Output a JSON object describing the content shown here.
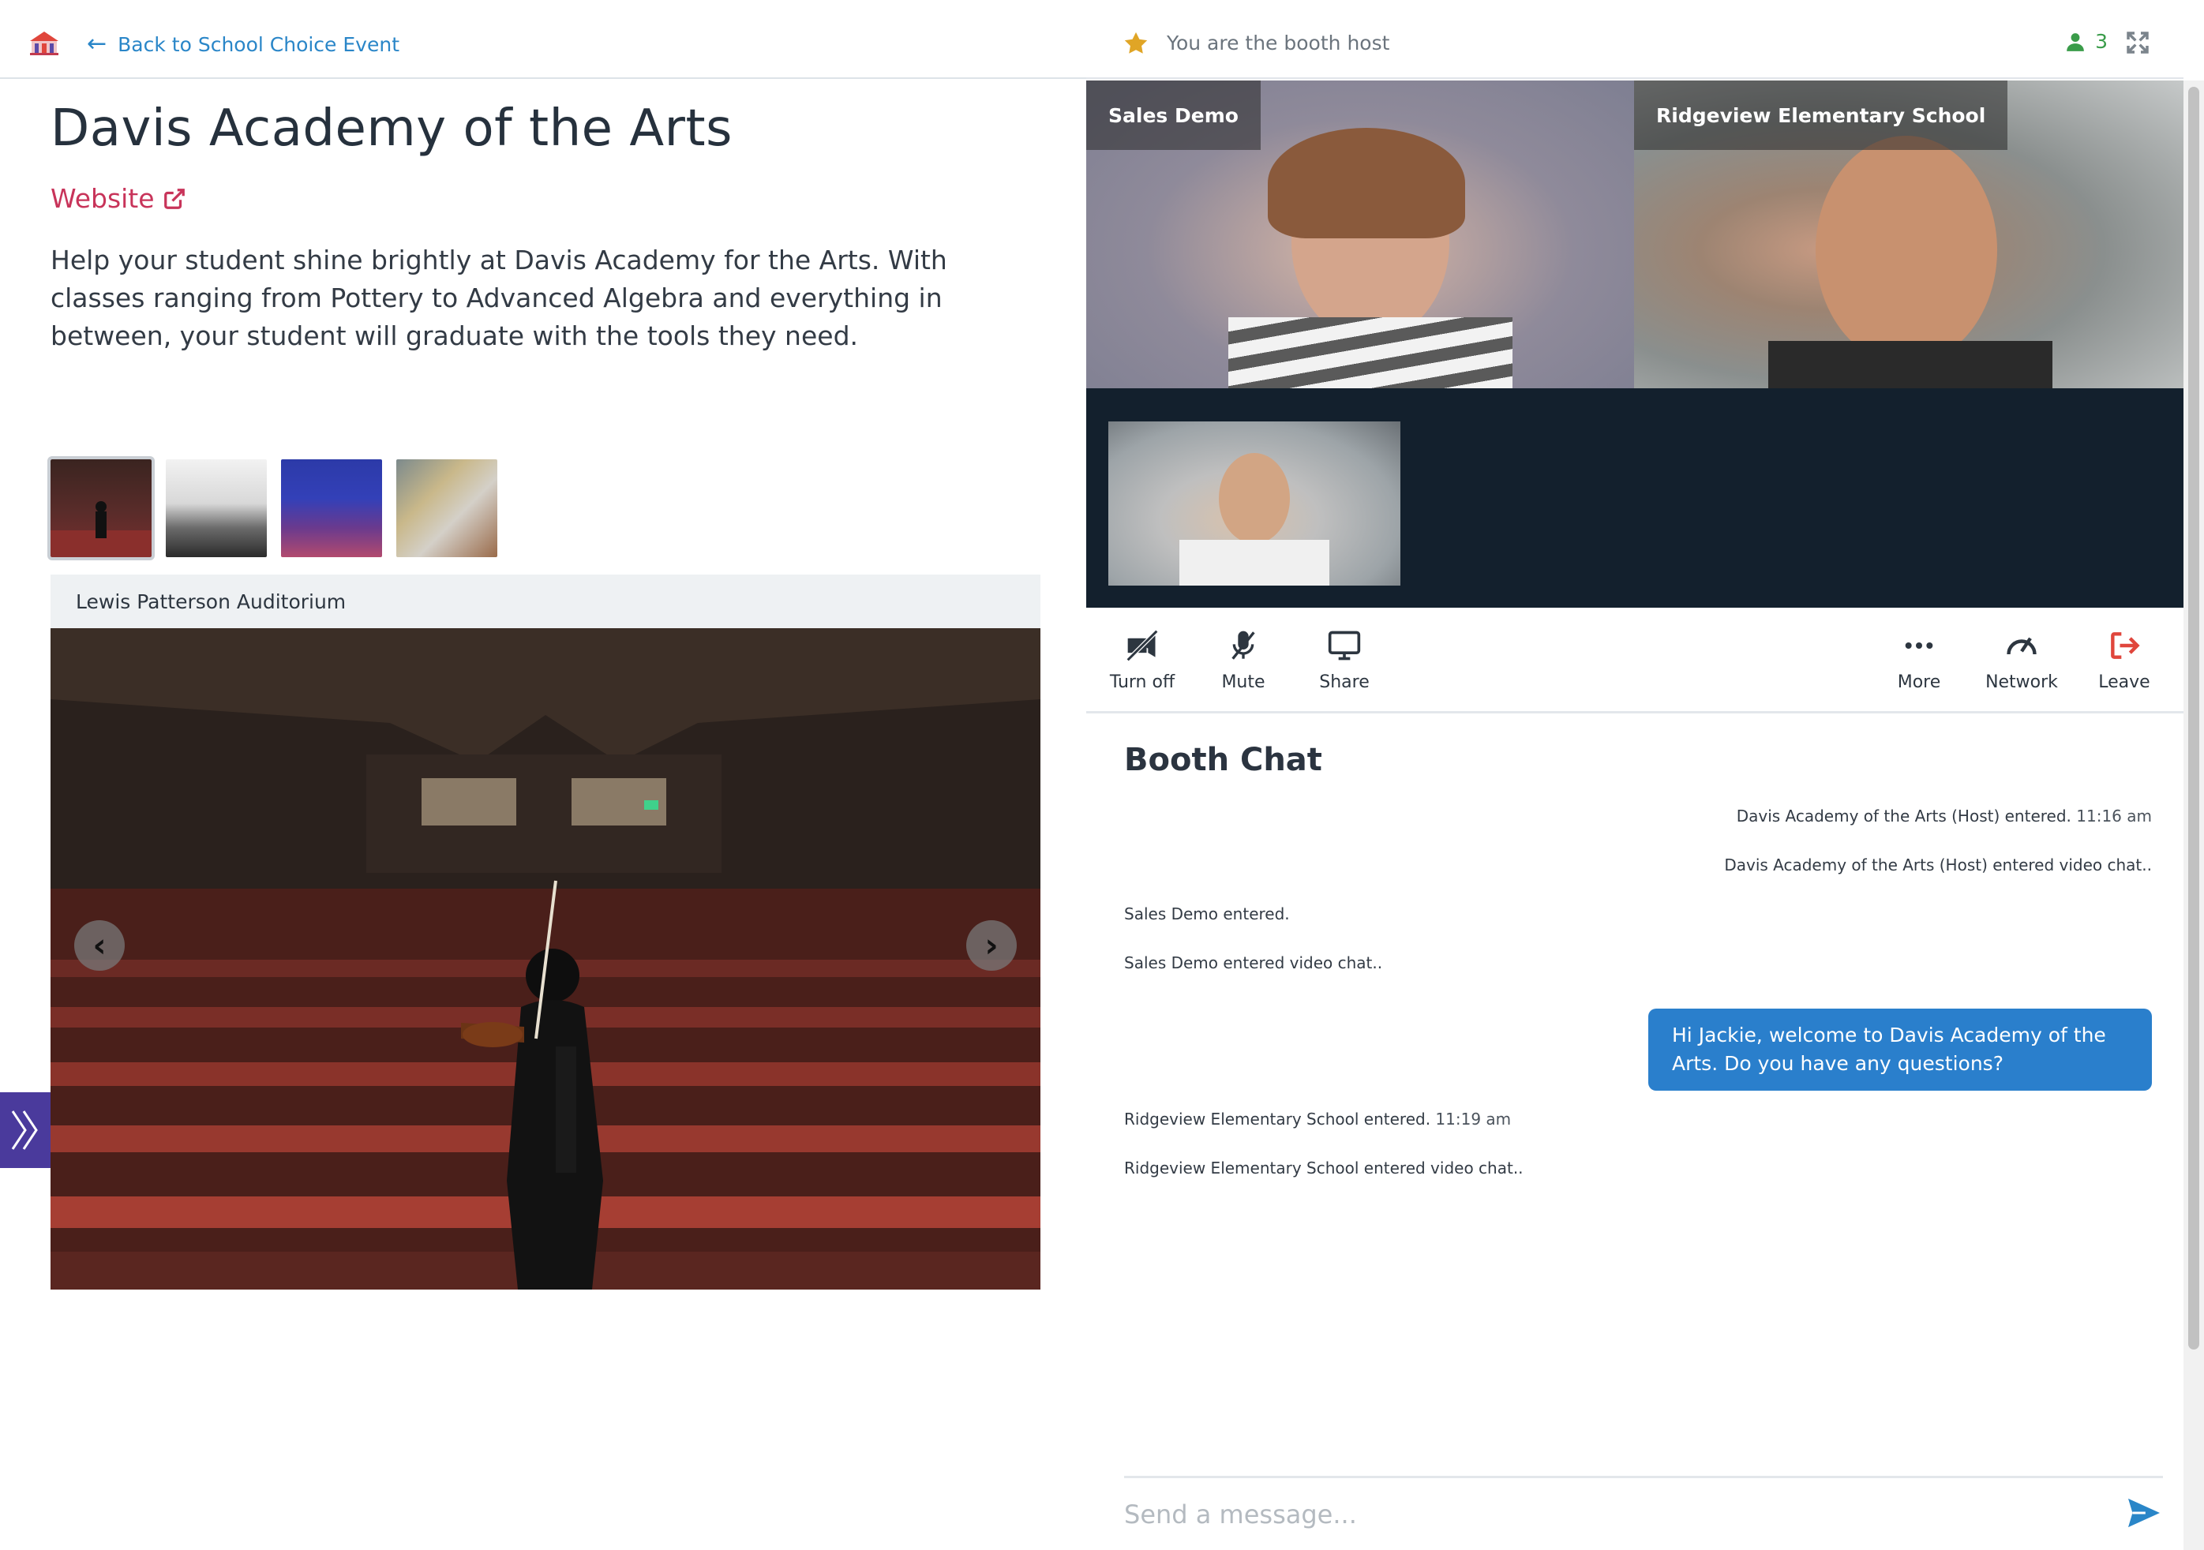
{
  "header": {
    "back_label": "Back to School Choice Event",
    "host_label": "You are the booth host",
    "participant_count": "3"
  },
  "school": {
    "title": "Davis Academy of the Arts",
    "website_label": "Website",
    "description": "Help your student shine brightly at Davis Academy for the Arts. With classes ranging from Pottery to Advanced Algebra and everything in between, your student will graduate with the tools they need."
  },
  "gallery": {
    "thumbnails": [
      "violinist-auditorium",
      "classroom",
      "stage-performance",
      "art-studio"
    ],
    "active_index": 0,
    "caption": "Lewis Patterson Auditorium"
  },
  "video": {
    "tiles": [
      {
        "label": "Sales Demo"
      },
      {
        "label": "Ridgeview Elementary School"
      },
      {
        "label": ""
      }
    ]
  },
  "controls": {
    "camera": "Turn off",
    "mute": "Mute",
    "share": "Share",
    "more": "More",
    "network": "Network",
    "leave": "Leave"
  },
  "chat": {
    "title": "Booth Chat",
    "messages": [
      {
        "text": "Davis Academy of the Arts (Host) entered.",
        "time": "11:16 am",
        "align": "right"
      },
      {
        "text": "Davis Academy of the Arts (Host) entered video chat..",
        "time": "",
        "align": "right"
      },
      {
        "text": "Sales Demo entered.",
        "time": "",
        "align": "left"
      },
      {
        "text": "Sales Demo entered video chat..",
        "time": "",
        "align": "left"
      },
      {
        "text": "Hi Jackie, welcome to Davis Academy of the Arts. Do you have any questions?",
        "time": "",
        "align": "bubble"
      },
      {
        "text": "Ridgeview Elementary School entered.",
        "time": "11:19 am",
        "align": "left"
      },
      {
        "text": "Ridgeview Elementary School entered video chat..",
        "time": "",
        "align": "left"
      }
    ],
    "input_placeholder": "Send a message..."
  },
  "colors": {
    "link_blue": "#2a86c8",
    "website_red": "#c8345a",
    "bubble_blue": "#2a7fcc",
    "participant_green": "#3a9c4a",
    "leave_red": "#e0463c",
    "star_gold": "#e0a526",
    "side_tab_purple": "#4a3a9c",
    "video_bg": "#13202d"
  }
}
